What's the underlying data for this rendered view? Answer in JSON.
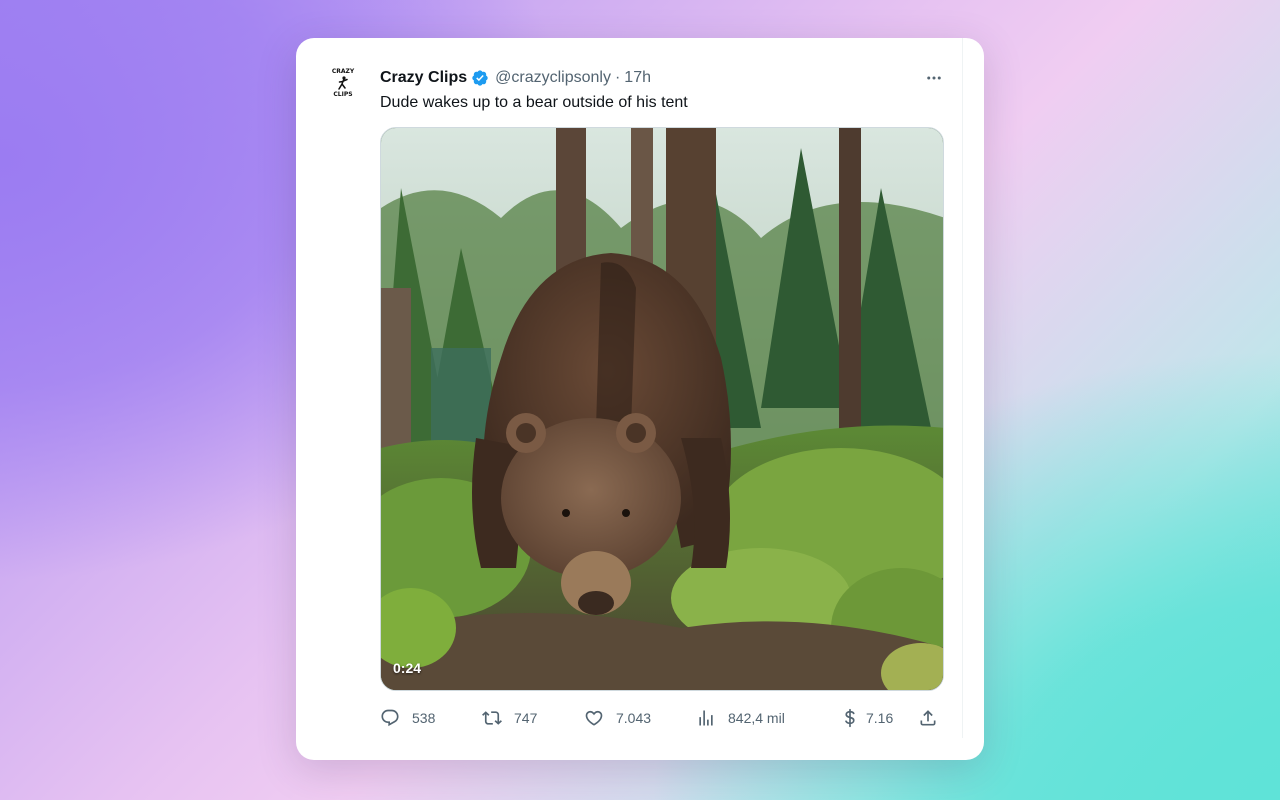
{
  "tweet": {
    "avatar_text_top": "CRAZY",
    "avatar_text_bottom": "CLIPS",
    "author_name": "Crazy Clips",
    "author_handle": "@crazyclipsonly",
    "separator": "·",
    "time": "17h",
    "text": "Dude wakes up to a bear outside of his tent",
    "verified": true,
    "media": {
      "type": "video",
      "subject": "brown bear in forest",
      "duration": "0:24"
    },
    "actions": {
      "replies": "538",
      "retweets": "747",
      "likes": "7.043",
      "views": "842,4 mil",
      "tips": "7.16"
    }
  },
  "icons": {
    "verified": "verified-badge-icon",
    "more": "more-horizontal-icon",
    "reply": "reply-icon",
    "retweet": "retweet-icon",
    "like": "heart-icon",
    "views": "views-chart-icon",
    "tip": "dollar-icon",
    "share": "share-icon"
  },
  "colors": {
    "verified_blue": "#1d9bf0",
    "text_primary": "#0f1419",
    "text_secondary": "#536471"
  }
}
